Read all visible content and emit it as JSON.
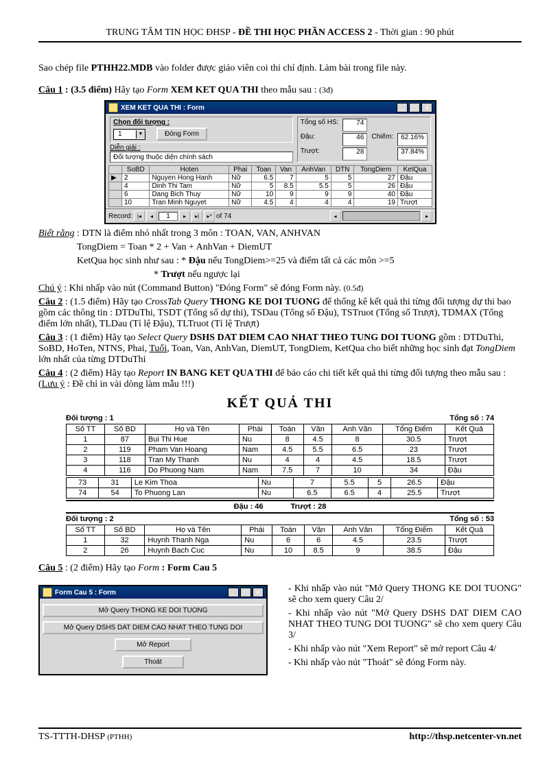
{
  "header": {
    "left": "TRUNG TÂM TIN HỌC ĐHSP - ",
    "center": "ĐỀ THI HỌC PHẦN ACCESS 2",
    "right": " - Thời gian : 90 phút"
  },
  "intro": {
    "p1a": "Sao chép file ",
    "file": "PTHH22.MDB",
    "p1b": " vào folder được giáo viên coi thi chỉ định. Làm bài trong file này."
  },
  "q1": {
    "label": "Câu 1",
    "pts": " : (3.5 điểm)",
    "text": "  Hãy tạo ",
    "form": "Form",
    "name": " XEM KET QUA THI",
    "tail": " theo mẫu sau : ",
    "pts2": "(3đ)"
  },
  "formwin": {
    "title": "XEM KET QUA THI : Form",
    "chondoituong": "Chọn đối tượng :",
    "combo_val": "1",
    "closebtn": "Đóng Form",
    "diengiai": "Diễn giải :",
    "diengiai_val": "Đối tượng thuộc diện chính sách",
    "stats": {
      "tongso": "Tổng số HS:",
      "tongso_v": "74",
      "dau": "Đậu:",
      "dau_v": "46",
      "chiem": "Chiếm:",
      "chiem_v": "62.16%",
      "truot": "Trượt:",
      "truot_v": "28",
      "truot_p": "37.84%"
    },
    "cols": [
      "",
      "SoBD",
      "Hoten",
      "Phai",
      "Toan",
      "Van",
      "AnhVan",
      "DTN",
      "TongDiem",
      "KetQua"
    ],
    "rows": [
      [
        "▶",
        "2",
        "Nguyen Hong Hanh",
        "Nữ",
        "6.5",
        "7",
        "5",
        "5",
        "27",
        "Đậu"
      ],
      [
        "",
        "4",
        "Dinh Thi Tam",
        "Nữ",
        "5",
        "8.5",
        "5.5",
        "5",
        "26",
        "Đậu"
      ],
      [
        "",
        "6",
        "Dang Bich Thuy",
        "Nữ",
        "10",
        "9",
        "9",
        "9",
        "40",
        "Đậu"
      ],
      [
        "",
        "10",
        "Tran Minh Nguyet",
        "Nữ",
        "4.5",
        "4",
        "4",
        "4",
        "19",
        "Trượt"
      ]
    ],
    "record": "Record:",
    "rec_pos": "1",
    "rec_of": "of  74"
  },
  "notes1": {
    "bietrang": "Biết rằng",
    "br_text": " : DTN là điểm nhỏ nhất trong 3 môn : TOAN, VAN, ANHVAN",
    "l2": "TongDiem =  Toan * 2 + Van + AnhVan + DiemUT",
    "l3a": "KetQua học sinh như sau : * ",
    "l3b": "Đậu",
    "l3c": " nếu TongDiem>=25 và điểm tất cả các môn >=5",
    "l4a": "* ",
    "l4b": "Trượt",
    "l4c": " nếu ngược lại",
    "chuy": "Chú ý",
    "chuy_text": " :  Khi nhấp vào nút (Command Button) \"Đóng Form\" sẽ đóng Form này. ",
    "chuy_pts": "(0.5đ)"
  },
  "q2": {
    "label": "Câu 2",
    "rest": " : (1.5 điểm) Hãy tạo ",
    "it": "CrossTab Query",
    "name": " THONG KE DOI TUONG",
    "tail": " để thống kê kết quả thi từng đối tượng dự thi bao gồm các thông tin : DTDuThi, TSDT (Tổng số dự thi), TSDau (Tổng số Đậu), TSTruot (Tổng số Trượt), TDMAX (Tổng điểm lớn nhất), TLDau (Tỉ lệ Đậu), TLTruot (Tỉ lệ Trượt)"
  },
  "q3": {
    "label": "Câu 3",
    "rest": " : (1 điểm) Hãy tạo ",
    "it": "Select Query",
    "name": " DSHS DAT DIEM CAO NHAT THEO TUNG DOI TUONG",
    "tail": " gồm : DTDuThi, SoBD, HoTen, NTNS, Phai, ",
    "tuoi": "Tuổi",
    "tail2": ", Toan, Van, AnhVan, DiemUT, TongDiem, KetQua cho biết những học sinh đạt ",
    "td": "TongDiem",
    "tail3": " lớn nhất của từng DTDuThi"
  },
  "q4": {
    "label": "Câu 4",
    "rest": " : (2 điểm) Hãy tạo ",
    "it": "Report",
    "name": " IN BANG KET QUA THI",
    "tail": " để báo cáo chi tiết kết quả thi từng đối tượng theo mẫu sau : (",
    "luuy": "Lưu ý",
    "tail2": " : Đề chỉ in vài dòng làm mẫu !!!)"
  },
  "report": {
    "title": "KẾT QUẢ THI",
    "g1": {
      "left": "Đối tượng : 1",
      "right": "Tổng số :     74"
    },
    "cols": [
      "Số TT",
      "Số BD",
      "Họ và Tên",
      "Phái",
      "Toán",
      "Văn",
      "Anh Văn",
      "Tổng Điểm",
      "Kết Quả"
    ],
    "g1rows": [
      [
        "1",
        "87",
        "Bui Thi Hue",
        "Nu",
        "8",
        "4.5",
        "8",
        "30.5",
        "Trượt"
      ],
      [
        "2",
        "119",
        "Pham Van Hoang",
        "Nam",
        "4.5",
        "5.5",
        "6.5",
        "23",
        "Trượt"
      ],
      [
        "3",
        "118",
        "Tran My Thanh",
        "Nu",
        "4",
        "4",
        "4.5",
        "18.5",
        "Trượt"
      ],
      [
        "4",
        "116",
        "Do Phuong Nam",
        "Nam",
        "7.5",
        "7",
        "10",
        "34",
        "Đậu"
      ]
    ],
    "g1rows2": [
      [
        "73",
        "31",
        "Le Kim Thoa",
        "Nu",
        "7",
        "5.5",
        "5",
        "26.5",
        "Đậu"
      ],
      [
        "74",
        "54",
        "To Phuong Lan",
        "Nu",
        "6.5",
        "6.5",
        "4",
        "25.5",
        "Trượt"
      ]
    ],
    "sum": {
      "dau": "Đậu :      46",
      "truot": "Trượt :     28"
    },
    "g2": {
      "left": "Đối tượng : 2",
      "right": "Tổng số :     53"
    },
    "g2rows": [
      [
        "1",
        "32",
        "Huynh Thanh Nga",
        "Nu",
        "6",
        "6",
        "4.5",
        "23.5",
        "Trượt"
      ],
      [
        "2",
        "26",
        "Huynh Bach Cuc",
        "Nu",
        "10",
        "8.5",
        "9",
        "38.5",
        "Đậu"
      ]
    ]
  },
  "q5": {
    "label": "Câu 5",
    "rest": " : (2 điểm)  Hãy tạo ",
    "it": "Form",
    "name": " : Form Cau 5"
  },
  "formcau5": {
    "title": "Form Cau 5 : Form",
    "b1": "Mở Query THONG KE DOI TUONG",
    "b2": "Mở Query DSHS DAT DIEM CAO NHAT THEO TUNG DOI",
    "b3": "Mở Report",
    "b4": "Thoát"
  },
  "explain": {
    "l1": "Khi nhấp vào nút \"Mở Query THONG KE DOI TUONG\" sẽ cho xem query Câu 2/",
    "l2": "Khi nhấp vào nút \"Mở Query DSHS DAT DIEM CAO NHAT THEO TUNG DOI TUONG\" sẽ cho xem query Câu 3/",
    "l3": "Khi nhấp vào nút \"Xem Report\" sẽ mở report Câu 4/",
    "l4": "Khi nhấp vào nút \"Thoát\" sẽ đóng Form này."
  },
  "footer": {
    "left_a": "TS-TTTH-DHSP ",
    "left_b": "(PTHH)",
    "right": "http://thsp.netcenter-vn.net"
  }
}
